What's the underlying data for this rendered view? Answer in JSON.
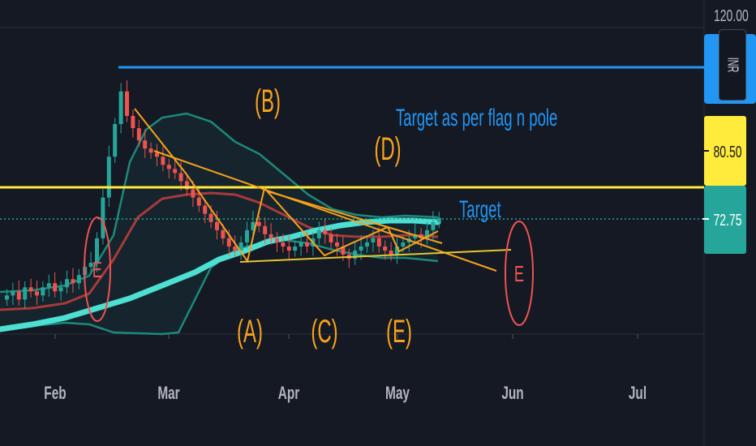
{
  "currency": "INR",
  "chart_data": {
    "type": "candlestick",
    "x_ticks": [
      "Feb",
      "Mar",
      "Apr",
      "May",
      "Jun",
      "Jul"
    ],
    "y_ticks": [
      "120.00"
    ],
    "price_labels": [
      {
        "value": "80.50",
        "bg": "#ffeb3b",
        "fg": "#131722"
      },
      {
        "value": "72.75",
        "bg": "#26a69a",
        "fg": "#ffffff"
      }
    ],
    "annotations": {
      "wave_b": "(B)",
      "wave_d": "(D)",
      "wave_a": "(A)",
      "wave_c": "(C)",
      "wave_e": "(E)",
      "e_circle_left": "E",
      "e_circle_right": "E",
      "target_flag": "Target as per flag n pole",
      "target": "Target"
    },
    "horizontal_levels": [
      {
        "name": "blue",
        "value": 108,
        "color": "#2196f3"
      },
      {
        "name": "yellow",
        "value": 80.5,
        "color": "#ffeb3b"
      },
      {
        "name": "current",
        "value": 72.75,
        "color": "#26a69a"
      }
    ],
    "candles_close_approx": [
      54,
      55,
      53,
      56,
      55,
      54,
      56,
      57,
      55,
      56,
      58,
      57,
      59,
      61,
      62,
      68,
      78,
      88,
      96,
      104,
      98,
      95,
      92,
      90,
      89,
      88,
      86,
      85,
      84,
      82,
      80,
      78,
      76,
      74,
      72,
      70,
      68,
      66,
      65,
      67,
      70,
      72,
      71,
      69,
      68,
      67,
      66,
      65,
      66,
      67,
      66,
      68,
      70,
      69,
      67,
      66,
      64,
      63,
      65,
      66,
      67,
      68,
      66,
      65,
      64,
      66,
      67,
      68,
      69,
      68,
      70,
      72,
      73
    ],
    "colors": {
      "up": "#26a69a",
      "down": "#ef5350",
      "orange": "#f7a21b",
      "teal_band": "#1b7a6e",
      "ema": "#4de0d2",
      "red_ma": "#a83a3a"
    }
  }
}
